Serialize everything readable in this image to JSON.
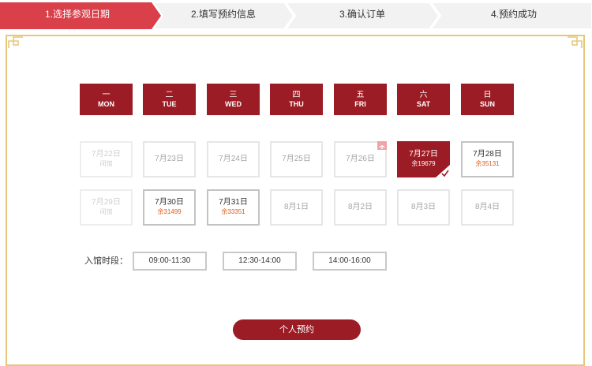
{
  "steps": [
    {
      "label": "1.选择参观日期",
      "active": true
    },
    {
      "label": "2.填写预约信息",
      "active": false
    },
    {
      "label": "3.确认订单",
      "active": false
    },
    {
      "label": "4.预约成功",
      "active": false
    }
  ],
  "week": [
    {
      "cn": "一",
      "en": "MON"
    },
    {
      "cn": "二",
      "en": "TUE"
    },
    {
      "cn": "三",
      "en": "WED"
    },
    {
      "cn": "四",
      "en": "THU"
    },
    {
      "cn": "五",
      "en": "FRI"
    },
    {
      "cn": "六",
      "en": "SAT"
    },
    {
      "cn": "日",
      "en": "SUN"
    }
  ],
  "calendar": {
    "row1": [
      {
        "date": "7月22日",
        "sub": "闭馆"
      },
      {
        "date": "7月23日",
        "sub": ""
      },
      {
        "date": "7月24日",
        "sub": ""
      },
      {
        "date": "7月25日",
        "sub": ""
      },
      {
        "date": "7月26日",
        "sub": ""
      },
      {
        "date": "7月27日",
        "sub": "余19679"
      },
      {
        "date": "7月28日",
        "sub": "余35131"
      }
    ],
    "row2": [
      {
        "date": "7月29日",
        "sub": "闭馆"
      },
      {
        "date": "7月30日",
        "sub": "余31499"
      },
      {
        "date": "7月31日",
        "sub": "余33351"
      },
      {
        "date": "8月1日",
        "sub": ""
      },
      {
        "date": "8月2日",
        "sub": ""
      },
      {
        "date": "8月3日",
        "sub": ""
      },
      {
        "date": "8月4日",
        "sub": ""
      }
    ]
  },
  "time": {
    "label": "入馆时段：",
    "slots": [
      "09:00-11:30",
      "12:30-14:00",
      "14:00-16:00"
    ]
  },
  "reserve_label": "个人预约",
  "colors": {
    "primary": "#9b1c24",
    "step_active": "#d9404a",
    "step_inactive": "#f2f2f2",
    "frame_gold": "#e6c87a",
    "remaining": "#e05a1c"
  },
  "icons": {
    "holiday": "holiday-tag-icon",
    "selected": "check-mark-icon",
    "corner": "corner-ornament-icon"
  }
}
